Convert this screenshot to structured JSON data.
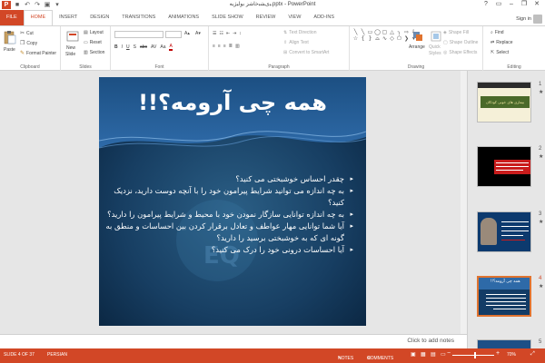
{
  "colors": {
    "accent": "#d24726",
    "ribbon_bg": "#ffffff",
    "workspace_bg": "#e6e6e6",
    "slide_dark": "#0c2f52",
    "selected_thumb": "#e0732f"
  },
  "titlebar": {
    "app_icon": "P",
    "title": "ﯿیﺸﺒﺧﺎﺷﺰ ﺑﻮﻟﯿﮋﯾﻪ.pptx - PowerPoint",
    "qat": [
      {
        "icon": "save-icon",
        "glyph": "■"
      },
      {
        "icon": "undo-icon",
        "glyph": "↶"
      },
      {
        "icon": "redo-icon",
        "glyph": "↷"
      },
      {
        "icon": "start-slideshow-icon",
        "glyph": "▣"
      },
      {
        "icon": "customize-qat-icon",
        "glyph": "▾"
      }
    ],
    "controls": [
      {
        "icon": "help-icon",
        "glyph": "?"
      },
      {
        "icon": "ribbon-display-icon",
        "glyph": "▭"
      },
      {
        "icon": "minimize-icon",
        "glyph": "–"
      },
      {
        "icon": "restore-icon",
        "glyph": "❐"
      },
      {
        "icon": "close-icon",
        "glyph": "✕"
      }
    ]
  },
  "tabs": [
    "FILE",
    "HOME",
    "INSERT",
    "DESIGN",
    "TRANSITIONS",
    "ANIMATIONS",
    "SLIDE SHOW",
    "REVIEW",
    "VIEW",
    "ADD-INS"
  ],
  "active_tab": "HOME",
  "signin": "Sign in",
  "ribbon": {
    "clipboard": {
      "label": "Clipboard",
      "paste": "Paste",
      "cut": "Cut",
      "copy": "Copy",
      "format_painter": "Format Painter"
    },
    "slides": {
      "label": "Slides",
      "new_slide": "New",
      "new_slide_2": "Slide",
      "layout": "Layout",
      "reset": "Reset",
      "section": "Section"
    },
    "font": {
      "label": "Font",
      "font_name": "",
      "font_size": "",
      "glyphs": [
        "B",
        "I",
        "U",
        "S",
        "abc",
        "AV",
        "Aa",
        "A"
      ]
    },
    "paragraph": {
      "label": "Paragraph",
      "text_direction": "Text Direction",
      "align_text": "Align Text",
      "convert_smartart": "Convert to SmartArt"
    },
    "drawing": {
      "label": "Drawing",
      "arrange": "Arrange",
      "quick_styles": "Quick",
      "quick_styles_2": "Styles",
      "shape_fill": "Shape Fill",
      "shape_outline": "Shape Outline",
      "shape_effects": "Shape Effects"
    },
    "editing": {
      "label": "Editing",
      "find": "Find",
      "replace": "Replace",
      "select": "Select"
    }
  },
  "slide": {
    "title": "همه چی آرومه؟!!",
    "bullets": [
      "چقدر احساس خوشبختی می کنید؟",
      "به چه اندازه می توانید شرایط پیرامون خود را با آنچه دوست دارید، نزدیک کنید؟",
      "به چه اندازه توانایی سازگار نمودن خود با محیط و شرایط پیرامون را دارید؟",
      "آیا شما توانایی مهار عواطف و تعادل برقرار کردن بین احساسات و منطق به گونه ای که به خوشبختی برسید را دارید؟",
      "آیا احساسات درونی خود را درک می کنید؟"
    ]
  },
  "thumbnails": [
    {
      "num": "1",
      "star": "★",
      "title": "بیماری های خونی کودکان"
    },
    {
      "num": "2",
      "star": "★"
    },
    {
      "num": "3",
      "star": "★"
    },
    {
      "num": "4",
      "star": "★",
      "title": "همه چی آرومه؟!!"
    },
    {
      "num": "5",
      "star": ""
    }
  ],
  "notes_placeholder": "Click to add notes",
  "status": {
    "slide_info": "SLIDE 4 OF 37",
    "language": "PERSIAN",
    "notes": "NOTES",
    "comments": "COMMENTS",
    "zoom": "70%",
    "zoom_level": 0.55
  }
}
